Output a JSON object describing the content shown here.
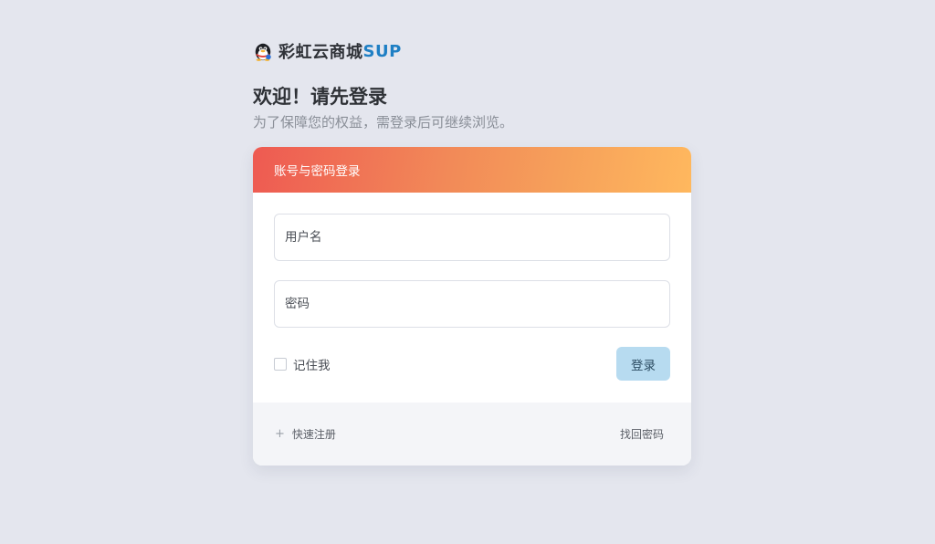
{
  "brand": {
    "name": "彩虹云商城",
    "accent": "SUP",
    "accent_color": "#1e7fc4",
    "logo_icon": "penguin-icon"
  },
  "intro": {
    "title": "欢迎！请先登录",
    "subtitle": "为了保障您的权益，需登录后可继续浏览。"
  },
  "card": {
    "header_title": "账号与密码登录",
    "username_placeholder": "用户名",
    "password_placeholder": "密码",
    "remember_label": "记住我",
    "login_label": "登录",
    "register_label": "快速注册",
    "register_icon": "plus-icon",
    "forgot_label": "找回密码",
    "gradient_colors": [
      "#ee5a52",
      "#ffb85e"
    ]
  }
}
